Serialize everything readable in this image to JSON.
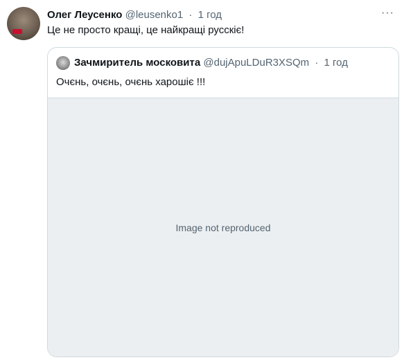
{
  "tweet": {
    "author_name": "Олег Леусенко",
    "author_handle": "@leusenko1",
    "time": "1 год",
    "text": "Це не просто кращі, це найкращі русскіє!",
    "more_icon": "more-horizontal-icon"
  },
  "quoted_tweet": {
    "author_name": "Зачмиритель московита",
    "author_handle": "@dujApuLDuR3XSQm",
    "time": "1 год",
    "text": "Очєнь, очєнь, очєнь харошіє !!!",
    "media_placeholder": "Image not reproduced"
  }
}
